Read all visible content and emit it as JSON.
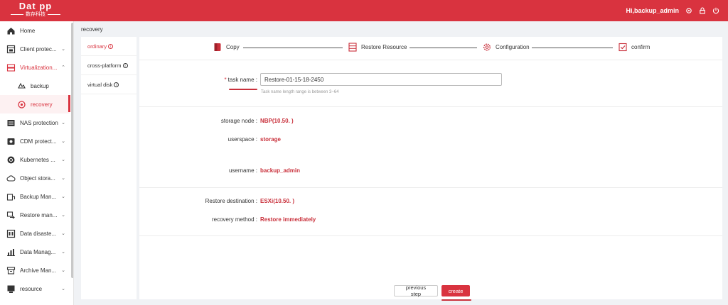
{
  "header": {
    "logo_text": "Dat  pp",
    "logo_subtext": "数存科技",
    "greeting": "Hi,backup_admin",
    "icons": [
      "gear-icon",
      "lock-icon",
      "logout-icon"
    ],
    "accent_color": "#d9333f"
  },
  "sidebar": {
    "items": [
      {
        "label": "Home",
        "icon": "home-icon"
      },
      {
        "label": "Client protec...",
        "icon": "client-icon"
      },
      {
        "label": "Virtualization...",
        "icon": "virtualization-icon"
      },
      {
        "label": "backup",
        "icon": "backup-icon"
      },
      {
        "label": "recovery",
        "icon": "recovery-icon"
      },
      {
        "label": "NAS protection",
        "icon": "nas-icon"
      },
      {
        "label": "CDM protect...",
        "icon": "cdm-icon"
      },
      {
        "label": "Kubernetes ...",
        "icon": "kubernetes-icon"
      },
      {
        "label": "Object stora...",
        "icon": "cloud-icon"
      },
      {
        "label": "Backup Man...",
        "icon": "backup-manage-icon"
      },
      {
        "label": "Restore man...",
        "icon": "restore-manage-icon"
      },
      {
        "label": "Data disaste...",
        "icon": "disaster-icon"
      },
      {
        "label": "Data Manag...",
        "icon": "data-manage-icon"
      },
      {
        "label": "Archive Man...",
        "icon": "archive-icon"
      },
      {
        "label": "resource",
        "icon": "resource-icon"
      }
    ]
  },
  "breadcrumb": "recovery",
  "tabs": [
    {
      "label": "ordinary"
    },
    {
      "label": "cross-platform"
    },
    {
      "label": "virtual disk"
    }
  ],
  "steps": [
    {
      "label": "Copy",
      "icon": "copy-icon"
    },
    {
      "label": "Restore Resource",
      "icon": "server-icon"
    },
    {
      "label": "Configuration",
      "icon": "gear-icon"
    },
    {
      "label": "confirm",
      "icon": "check-box-icon"
    }
  ],
  "form": {
    "task_name_label": "task name :",
    "task_name_value": "Restore-01-15-18-2450",
    "task_name_hint": "Task name length range is between 3~64",
    "storage_node_label": "storage node :",
    "storage_node_value": "NBP(10.50.   )",
    "userspace_label": "userspace :",
    "userspace_value": "storage",
    "username_label": "username :",
    "username_value": "backup_admin",
    "restore_destination_label": "Restore destination :",
    "restore_destination_value": "ESXi(10.50.    )",
    "recovery_method_label": "recovery method :",
    "recovery_method_value": "Restore immediately"
  },
  "buttons": {
    "previous_step": "previous step",
    "create": "create"
  }
}
